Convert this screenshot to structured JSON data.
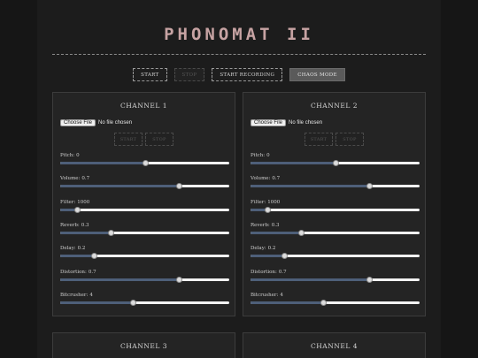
{
  "app": {
    "title": "PHONOMAT II"
  },
  "controls": {
    "start": "START",
    "stop": "STOP",
    "start_recording": "START RECORDING",
    "chaos_mode": "CHAOS MODE"
  },
  "channels": [
    {
      "title": "CHANNEL 1",
      "file": {
        "button": "Choose File",
        "status": "No file chosen"
      },
      "start": "START",
      "stop": "STOP",
      "sliders": [
        {
          "label": "Pitch:",
          "value": "0",
          "fraction": 0.5
        },
        {
          "label": "Volume:",
          "value": "0.7",
          "fraction": 0.7
        },
        {
          "label": "Filter:",
          "value": "1000",
          "fraction": 0.1
        },
        {
          "label": "Reverb:",
          "value": "0.3",
          "fraction": 0.3
        },
        {
          "label": "Delay:",
          "value": "0.2",
          "fraction": 0.2
        },
        {
          "label": "Distortion:",
          "value": "0.7",
          "fraction": 0.7
        },
        {
          "label": "Bitcrusher:",
          "value": "4",
          "fraction": 0.43
        }
      ]
    },
    {
      "title": "CHANNEL 2",
      "file": {
        "button": "Choose File",
        "status": "No file chosen"
      },
      "start": "START",
      "stop": "STOP",
      "sliders": [
        {
          "label": "Pitch:",
          "value": "0",
          "fraction": 0.5
        },
        {
          "label": "Volume:",
          "value": "0.7",
          "fraction": 0.7
        },
        {
          "label": "Filter:",
          "value": "1000",
          "fraction": 0.1
        },
        {
          "label": "Reverb:",
          "value": "0.3",
          "fraction": 0.3
        },
        {
          "label": "Delay:",
          "value": "0.2",
          "fraction": 0.2
        },
        {
          "label": "Distortion:",
          "value": "0.7",
          "fraction": 0.7
        },
        {
          "label": "Bitcrusher:",
          "value": "4",
          "fraction": 0.43
        }
      ]
    },
    {
      "title": "CHANNEL 3"
    },
    {
      "title": "CHANNEL 4"
    }
  ]
}
